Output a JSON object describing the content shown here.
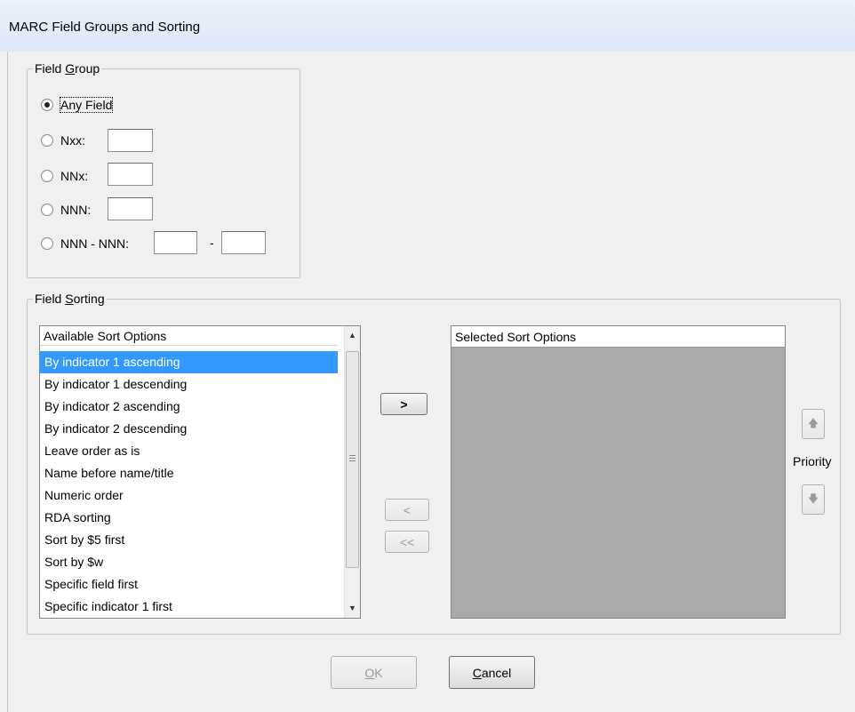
{
  "window": {
    "title": "MARC Field Groups and Sorting"
  },
  "field_group": {
    "legend_prefix": "Field ",
    "legend_accel": "G",
    "legend_suffix": "roup",
    "options": [
      {
        "label": "Any Field",
        "checked": true
      },
      {
        "label": "Nxx:",
        "checked": false
      },
      {
        "label": "NNx:",
        "checked": false
      },
      {
        "label": "NNN:",
        "checked": false
      },
      {
        "label": "NNN - NNN:",
        "checked": false
      }
    ],
    "range_separator": "-"
  },
  "field_sorting": {
    "legend_prefix": "Field ",
    "legend_accel": "S",
    "legend_suffix": "orting",
    "available": {
      "header": "Available Sort Options",
      "items": [
        "By indicator 1 ascending",
        "By indicator 1 descending",
        "By indicator 2 ascending",
        "By indicator 2 descending",
        "Leave order as is",
        "Name before name/title",
        "Numeric order",
        "RDA sorting",
        "Sort by $5 first",
        "Sort by $w",
        "Specific field first",
        "Specific indicator 1 first"
      ],
      "selected_index": 0
    },
    "selected": {
      "header": "Selected Sort Options"
    },
    "buttons": {
      "add": ">",
      "remove": "<",
      "remove_all": "<<"
    },
    "priority_label": "Priority"
  },
  "footer": {
    "ok_accel": "O",
    "ok_rest": "K",
    "cancel_accel": "C",
    "cancel_rest": "ancel"
  }
}
